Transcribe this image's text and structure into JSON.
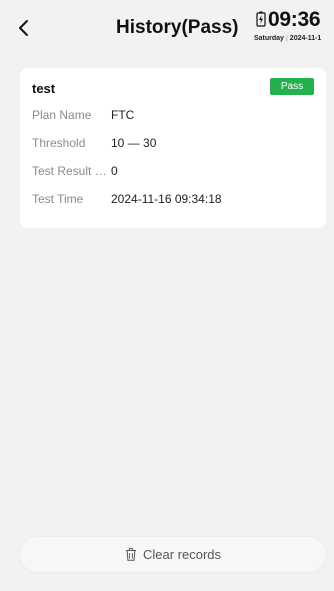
{
  "header": {
    "back_icon": "chevron-left-icon",
    "title": "History(Pass)",
    "battery_icon": "battery-charging-icon",
    "time": "09:36",
    "weekday": "Saturday",
    "date": "2024-11-1"
  },
  "record": {
    "name": "test",
    "status": "Pass",
    "status_color": "#22b14c",
    "fields": [
      {
        "label": "Plan Name",
        "value": "FTC"
      },
      {
        "label": "Threshold",
        "value": "10 — 30"
      },
      {
        "label": "Test Result V...",
        "value": "0"
      },
      {
        "label": "Test Time",
        "value": "2024-11-16 09:34:18"
      }
    ]
  },
  "footer": {
    "clear_icon": "trash-icon",
    "clear_label": "Clear records"
  }
}
